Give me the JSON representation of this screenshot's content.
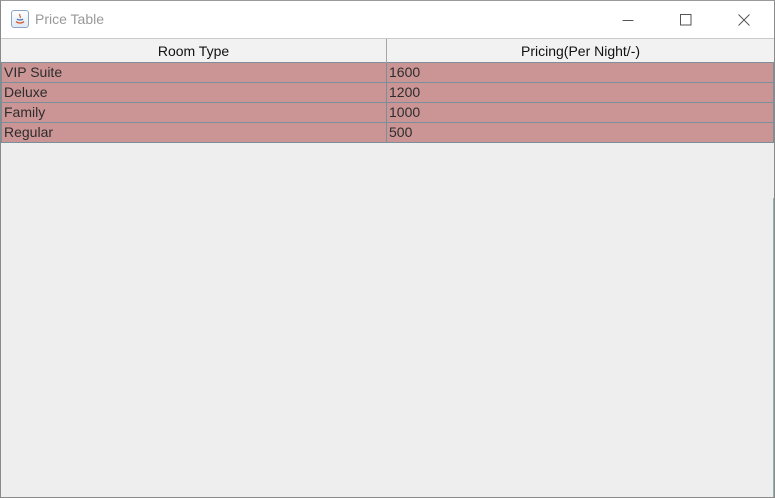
{
  "window": {
    "title": "Price Table",
    "controls": {
      "minimize_icon": "minimize-icon",
      "maximize_icon": "maximize-icon",
      "close_icon": "close-icon"
    }
  },
  "table": {
    "columns": [
      "Room Type",
      "Pricing(Per Night/-)"
    ],
    "rows": [
      [
        "VIP Suite",
        "1600"
      ],
      [
        "Deluxe",
        "1200"
      ],
      [
        "Family",
        "1000"
      ],
      [
        "Regular",
        "500"
      ]
    ],
    "row_color": "#cb9595",
    "grid_color": "#7a8f99",
    "header_background": "#f2f2f2",
    "panel_background": "#eeeeee"
  }
}
